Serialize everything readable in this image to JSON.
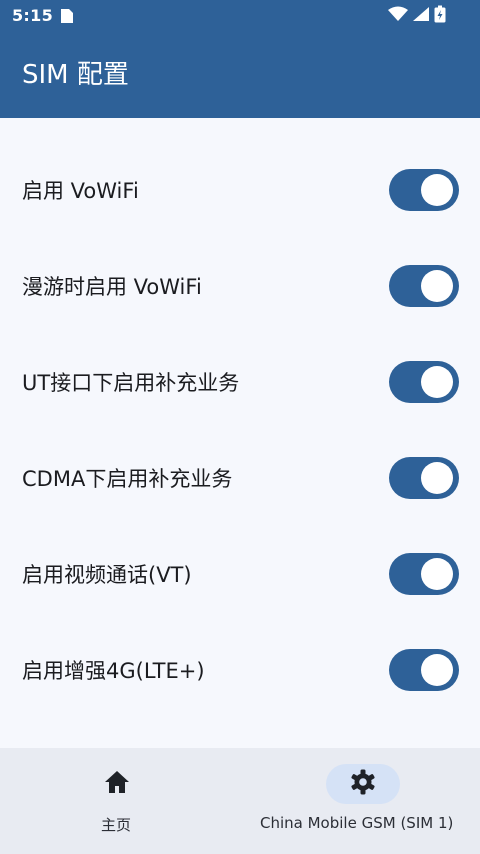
{
  "status_bar": {
    "time": "5:15",
    "left_icon": "sim-card-icon",
    "right_icons": [
      "wifi-icon",
      "signal-icon",
      "battery-charging-icon"
    ]
  },
  "app_bar": {
    "title": "SIM 配置"
  },
  "settings": [
    {
      "label": "启用 VoWiFi",
      "enabled": true
    },
    {
      "label": "漫游时启用 VoWiFi",
      "enabled": true
    },
    {
      "label": "UT接口下启用补充业务",
      "enabled": true
    },
    {
      "label": "CDMA下启用补充业务",
      "enabled": true
    },
    {
      "label": "启用视频通话(VT)",
      "enabled": true
    },
    {
      "label": "启用增强4G(LTE+)",
      "enabled": true
    }
  ],
  "bottom_nav": {
    "items": [
      {
        "label": "主页",
        "icon": "home-icon",
        "selected": false
      },
      {
        "label": "China Mobile GSM (SIM 1)",
        "icon": "gear-icon",
        "selected": true
      }
    ]
  },
  "colors": {
    "primary": "#2e6198",
    "background": "#f6f8fd",
    "nav_background": "#e8ebf2",
    "nav_indicator": "#d5e2f6"
  }
}
